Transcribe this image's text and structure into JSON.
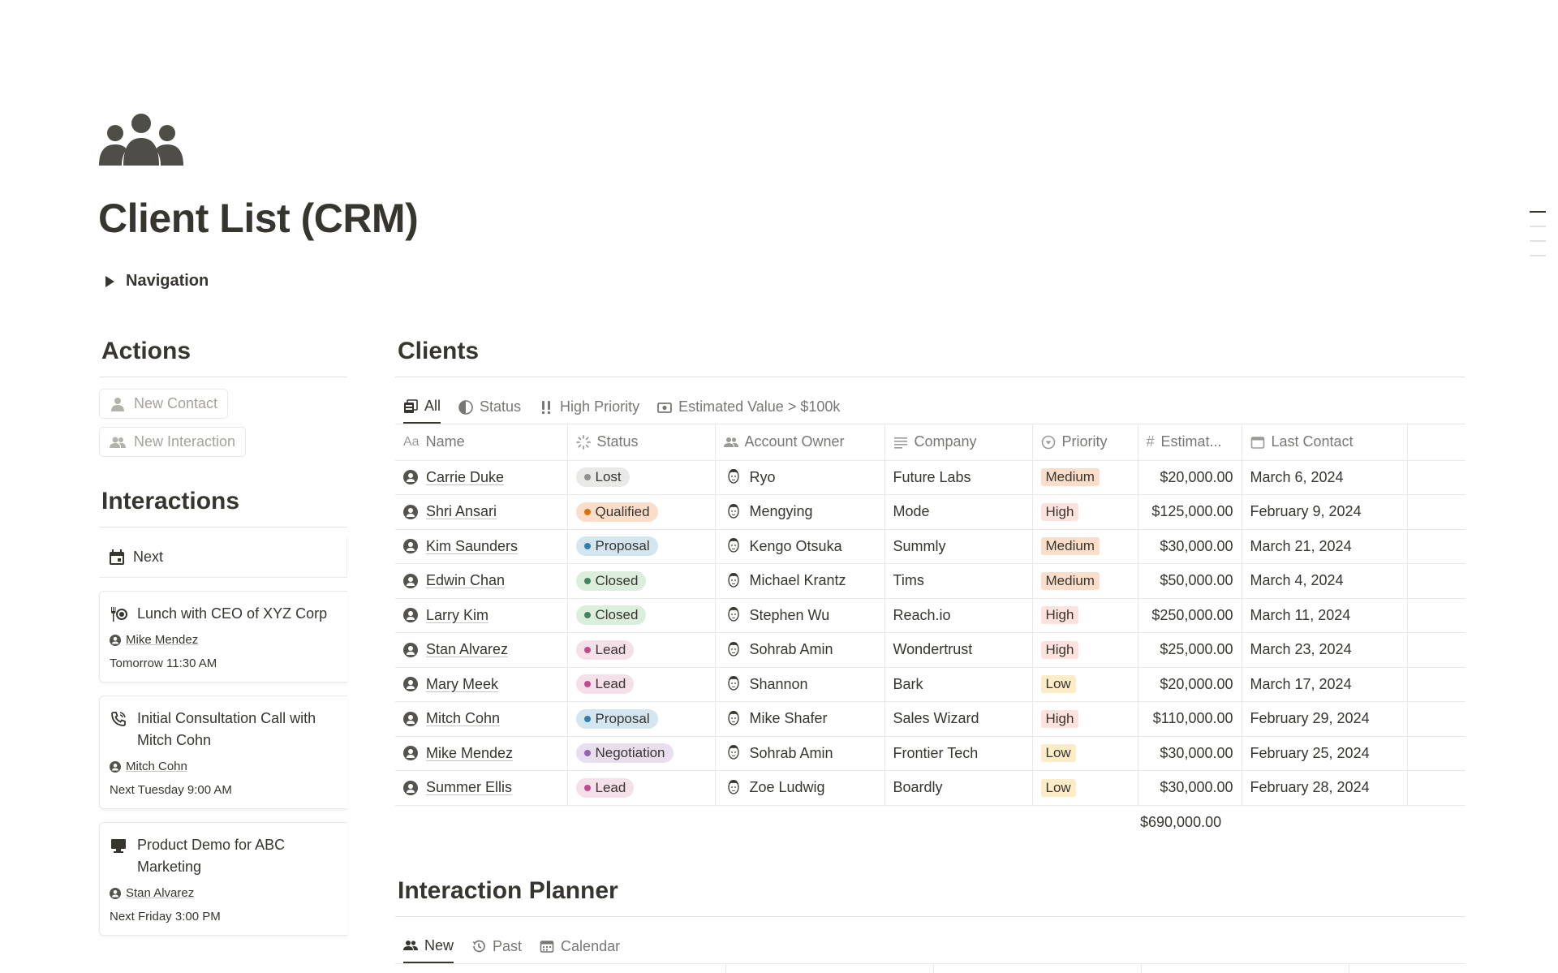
{
  "page": {
    "title": "Client List (CRM)",
    "icon": "people-group-icon",
    "toggle_label": "Navigation"
  },
  "actions": {
    "heading": "Actions",
    "buttons": [
      {
        "label": "New Contact",
        "icon": "person-icon"
      },
      {
        "label": "New Interaction",
        "icon": "people-icon"
      }
    ]
  },
  "interactions": {
    "heading": "Interactions",
    "tab_label": "Next",
    "cards": [
      {
        "title": "Lunch with CEO of XYZ Corp",
        "icon": "dining-icon",
        "person": "Mike Mendez",
        "when": "Tomorrow 11:30 AM"
      },
      {
        "title": "Initial Consultation Call with Mitch Cohn",
        "icon": "phone-icon",
        "person": "Mitch Cohn",
        "when": "Next Tuesday 9:00 AM"
      },
      {
        "title": "Product Demo for ABC Marketing",
        "icon": "monitor-icon",
        "person": "Stan Alvarez",
        "when": "Next Friday 3:00 PM"
      }
    ]
  },
  "clients": {
    "heading": "Clients",
    "views": [
      "All",
      "Status",
      "High Priority",
      "Estimated Value > $100k"
    ],
    "columns": [
      "Name",
      "Status",
      "Account Owner",
      "Company",
      "Priority",
      "Estimat...",
      "Last Contact"
    ],
    "rows": [
      {
        "name": "Carrie Duke",
        "status": "Lost",
        "owner": "Ryo",
        "company": "Future Labs",
        "priority": "Medium",
        "value": "$20,000.00",
        "last": "March 6, 2024"
      },
      {
        "name": "Shri Ansari",
        "status": "Qualified",
        "owner": "Mengying",
        "company": "Mode",
        "priority": "High",
        "value": "$125,000.00",
        "last": "February 9, 2024"
      },
      {
        "name": "Kim Saunders",
        "status": "Proposal",
        "owner": "Kengo Otsuka",
        "company": "Summly",
        "priority": "Medium",
        "value": "$30,000.00",
        "last": "March 21, 2024"
      },
      {
        "name": "Edwin Chan",
        "status": "Closed",
        "owner": "Michael Krantz",
        "company": "Tims",
        "priority": "Medium",
        "value": "$50,000.00",
        "last": "March 4, 2024"
      },
      {
        "name": "Larry Kim",
        "status": "Closed",
        "owner": "Stephen Wu",
        "company": "Reach.io",
        "priority": "High",
        "value": "$250,000.00",
        "last": "March 11, 2024"
      },
      {
        "name": "Stan Alvarez",
        "status": "Lead",
        "owner": "Sohrab Amin",
        "company": "Wondertrust",
        "priority": "High",
        "value": "$25,000.00",
        "last": "March 23, 2024"
      },
      {
        "name": "Mary Meek",
        "status": "Lead",
        "owner": "Shannon",
        "company": "Bark",
        "priority": "Low",
        "value": "$20,000.00",
        "last": "March 17, 2024"
      },
      {
        "name": "Mitch Cohn",
        "status": "Proposal",
        "owner": "Mike Shafer",
        "company": "Sales Wizard",
        "priority": "High",
        "value": "$110,000.00",
        "last": "February 29, 2024"
      },
      {
        "name": "Mike Mendez",
        "status": "Negotiation",
        "owner": "Sohrab Amin",
        "company": "Frontier Tech",
        "priority": "Low",
        "value": "$30,000.00",
        "last": "February 25, 2024"
      },
      {
        "name": "Summer Ellis",
        "status": "Lead",
        "owner": "Zoe Ludwig",
        "company": "Boardly",
        "priority": "Low",
        "value": "$30,000.00",
        "last": "February 28, 2024"
      }
    ],
    "sum": "$690,000.00"
  },
  "status_colors": {
    "Lost": {
      "bg": "#e9e9e7",
      "dot": "#91918e"
    },
    "Qualified": {
      "bg": "#fadec9",
      "dot": "#d9730d"
    },
    "Proposal": {
      "bg": "#d3e5ef",
      "dot": "#337ea9"
    },
    "Closed": {
      "bg": "#dbeddb",
      "dot": "#448361"
    },
    "Lead": {
      "bg": "#f5e0e9",
      "dot": "#c14c8a"
    },
    "Negotiation": {
      "bg": "#e8deee",
      "dot": "#9065b0"
    }
  },
  "priority_colors": {
    "Medium": "#fadec9",
    "High": "#ffe2dd",
    "Low": "#fdecc8"
  },
  "planner": {
    "heading": "Interaction Planner",
    "views": [
      "New",
      "Past",
      "Calendar"
    ]
  }
}
